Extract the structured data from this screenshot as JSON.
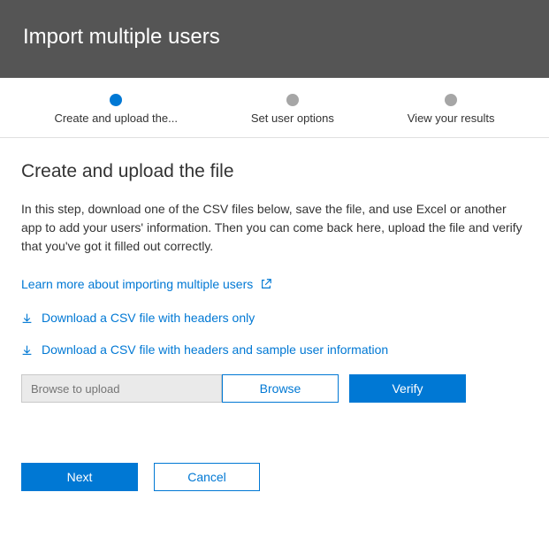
{
  "header": {
    "title": "Import multiple users"
  },
  "stepper": {
    "steps": [
      {
        "label": "Create and upload the...",
        "active": true
      },
      {
        "label": "Set user options",
        "active": false
      },
      {
        "label": "View your results",
        "active": false
      }
    ]
  },
  "content": {
    "title": "Create and upload the file",
    "description": "In this step, download one of the CSV files below, save the file, and use Excel or another app to add your users' information. Then you can come back here, upload the file and verify that you've got it filled out correctly.",
    "learnMoreLink": "Learn more about importing multiple users",
    "downloadHeadersOnly": "Download a CSV file with headers only",
    "downloadHeadersSample": "Download a CSV file with headers and sample user information",
    "upload": {
      "placeholder": "Browse to upload",
      "browseLabel": "Browse",
      "verifyLabel": "Verify"
    }
  },
  "footer": {
    "nextLabel": "Next",
    "cancelLabel": "Cancel"
  }
}
